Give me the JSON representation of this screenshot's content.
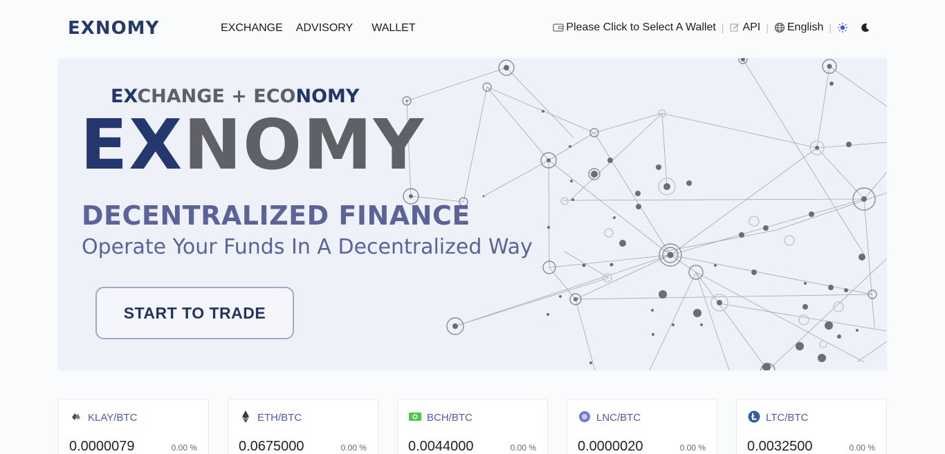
{
  "header": {
    "logo_ex": "EX",
    "logo_nomy": "NOMY",
    "nav": {
      "exchange": "EXCHANGE",
      "advisory": "ADVISORY",
      "wallet": "WALLET"
    },
    "wallet_select": "Please Click to Select A Wallet",
    "api": "API",
    "language": "English",
    "icons": {
      "wallet": "wallet-icon",
      "api": "edit-icon",
      "language": "globe-icon",
      "light_theme": "sun-icon",
      "dark_theme": "moon-icon"
    }
  },
  "hero": {
    "tagline_ex": "EX",
    "tagline_mid": "CHANGE + ECO",
    "tagline_nomy": "NOMY",
    "logo_ex": "EX",
    "logo_nomy": "NOMY",
    "headline": "DECENTRALIZED FINANCE",
    "subline": "Operate Your Funds In A Decentralized Way",
    "cta": "START TO TRADE"
  },
  "markets": [
    {
      "pair": "KLAY/BTC",
      "price": "0.0000079",
      "change": "0.00 %",
      "icon": "klay-coin-icon",
      "color": "#5b4a3e"
    },
    {
      "pair": "ETH/BTC",
      "price": "0.0675000",
      "change": "0.00 %",
      "icon": "eth-coin-icon",
      "color": "#3c3c3d"
    },
    {
      "pair": "BCH/BTC",
      "price": "0.0044000",
      "change": "0.00 %",
      "icon": "bch-coin-icon",
      "color": "#4cc947"
    },
    {
      "pair": "LNC/BTC",
      "price": "0.0000020",
      "change": "0.00 %",
      "icon": "lnc-coin-icon",
      "color": "#6f7ad8"
    },
    {
      "pair": "LTC/BTC",
      "price": "0.0032500",
      "change": "0.00 %",
      "icon": "ltc-coin-icon",
      "color": "#345d9d"
    }
  ],
  "colors": {
    "brand_navy": "#24376f",
    "brand_grey": "#5f6167",
    "accent_text": "#5b6398",
    "pair_text": "#4e5aa8"
  }
}
